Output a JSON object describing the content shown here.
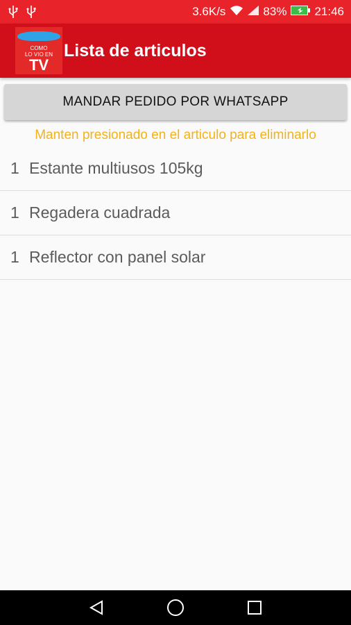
{
  "status_bar": {
    "speed": "3.6K/s",
    "battery": "83%",
    "time": "21:46"
  },
  "app_bar": {
    "title": "Lista de articulos",
    "logo_line1": "COMO",
    "logo_line2": "LO VIO EN",
    "logo_line3": "TV"
  },
  "send_button": {
    "label": "MANDAR PEDIDO POR WHATSAPP"
  },
  "hint": "Manten presionado en el articulo para eliminarlo",
  "items": [
    {
      "qty": "1",
      "name": "Estante multiusos 105kg"
    },
    {
      "qty": "1",
      "name": "Regadera cuadrada"
    },
    {
      "qty": "1",
      "name": "Reflector con panel solar"
    }
  ],
  "colors": {
    "status_bar": "#e8232a",
    "app_bar": "#d10f1a",
    "hint": "#f2b21c"
  }
}
